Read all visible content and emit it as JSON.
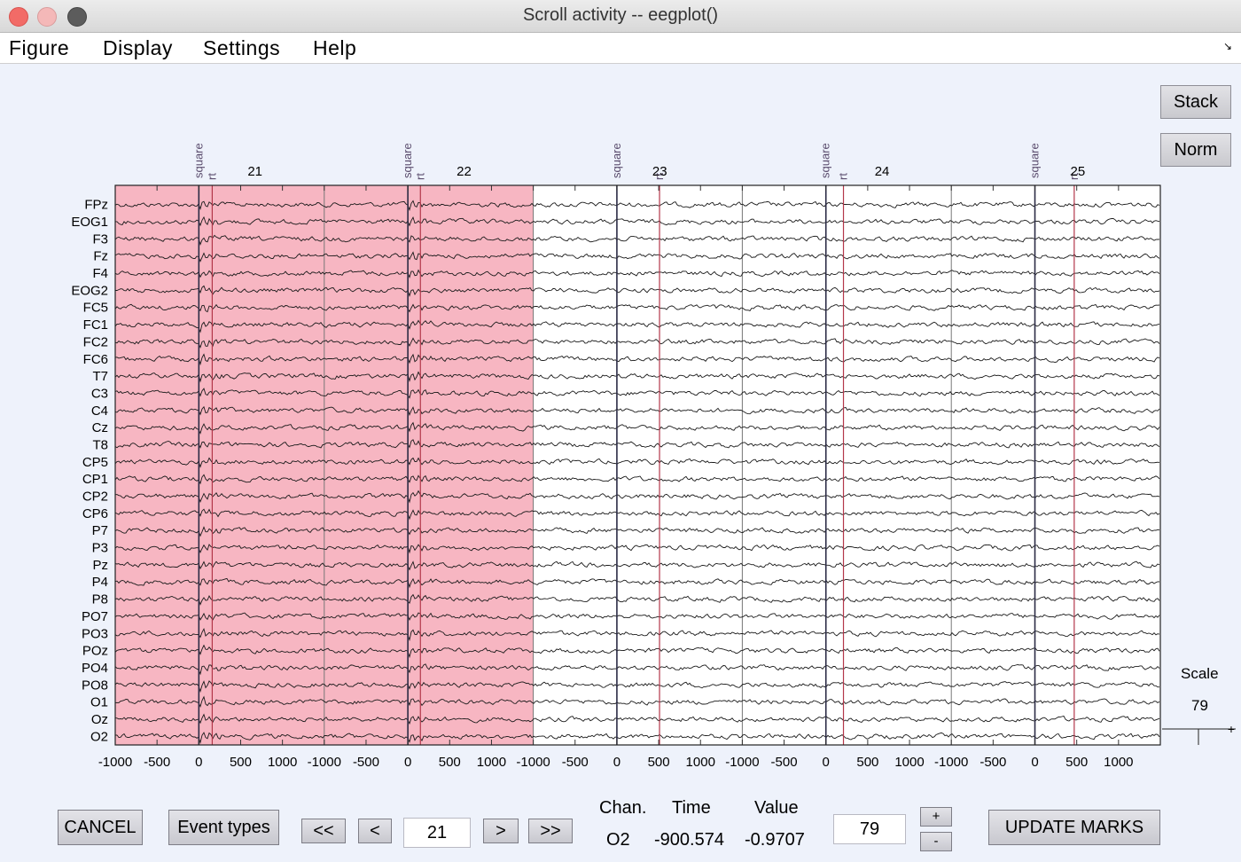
{
  "window": {
    "title": "Scroll activity -- eegplot()"
  },
  "menu": [
    "Figure",
    "Display",
    "Settings",
    "Help"
  ],
  "side_buttons": {
    "stack": "Stack",
    "norm": "Norm"
  },
  "scale": {
    "label": "Scale",
    "value": "79"
  },
  "plot": {
    "channels": [
      "FPz",
      "EOG1",
      "F3",
      "Fz",
      "F4",
      "EOG2",
      "FC5",
      "FC1",
      "FC2",
      "FC6",
      "T7",
      "C3",
      "C4",
      "Cz",
      "T8",
      "CP5",
      "CP1",
      "CP2",
      "CP6",
      "P7",
      "P3",
      "Pz",
      "P4",
      "P8",
      "PO7",
      "PO3",
      "POz",
      "PO4",
      "PO8",
      "O1",
      "Oz",
      "O2"
    ],
    "epochs": [
      {
        "number": "21",
        "x_ticks": [
          "-1000",
          "-500",
          "0",
          "500",
          "1000"
        ],
        "events": [
          {
            "type": "square",
            "latency": 0
          },
          {
            "type": "rt",
            "latency": 160
          }
        ]
      },
      {
        "number": "22",
        "x_ticks": [
          "-1000",
          "-500",
          "0",
          "500",
          "1000"
        ],
        "events": [
          {
            "type": "square",
            "latency": 0
          },
          {
            "type": "rt",
            "latency": 150
          }
        ]
      },
      {
        "number": "23",
        "x_ticks": [
          "-1000",
          "-500",
          "0",
          "500",
          "1000"
        ],
        "events": [
          {
            "type": "square",
            "latency": 0
          },
          {
            "type": "rt",
            "latency": 510
          }
        ]
      },
      {
        "number": "24",
        "x_ticks": [
          "-1000",
          "-500",
          "0",
          "500",
          "1000"
        ],
        "events": [
          {
            "type": "square",
            "latency": 0
          },
          {
            "type": "rt",
            "latency": 210
          }
        ]
      },
      {
        "number": "25",
        "x_ticks": [
          "-1000",
          "-500",
          "0",
          "500",
          "1000"
        ],
        "events": [
          {
            "type": "square",
            "latency": 0
          },
          {
            "type": "rt",
            "latency": 470
          }
        ]
      }
    ],
    "epoch_range_ms": [
      -1000,
      1500
    ],
    "rejected_epochs": [
      "21",
      "22"
    ],
    "colors": {
      "reject_fill": "#f7b6c2",
      "trace": "#1a1a1a",
      "event_line": "#2b2b45",
      "rt_line": "#b3374a",
      "event_label": "#5b4d6e"
    }
  },
  "footer": {
    "cancel": "CANCEL",
    "event_types": "Event types",
    "nav": {
      "first": "<<",
      "prev": "<",
      "next": ">",
      "last": ">>",
      "epoch_value": "21"
    },
    "info": {
      "chan_label": "Chan.",
      "time_label": "Time",
      "value_label": "Value",
      "chan": "O2",
      "time": "-900.574",
      "value": "-0.9707"
    },
    "scale_value": "79",
    "plus": "+",
    "minus": "-",
    "update": "UPDATE MARKS"
  }
}
